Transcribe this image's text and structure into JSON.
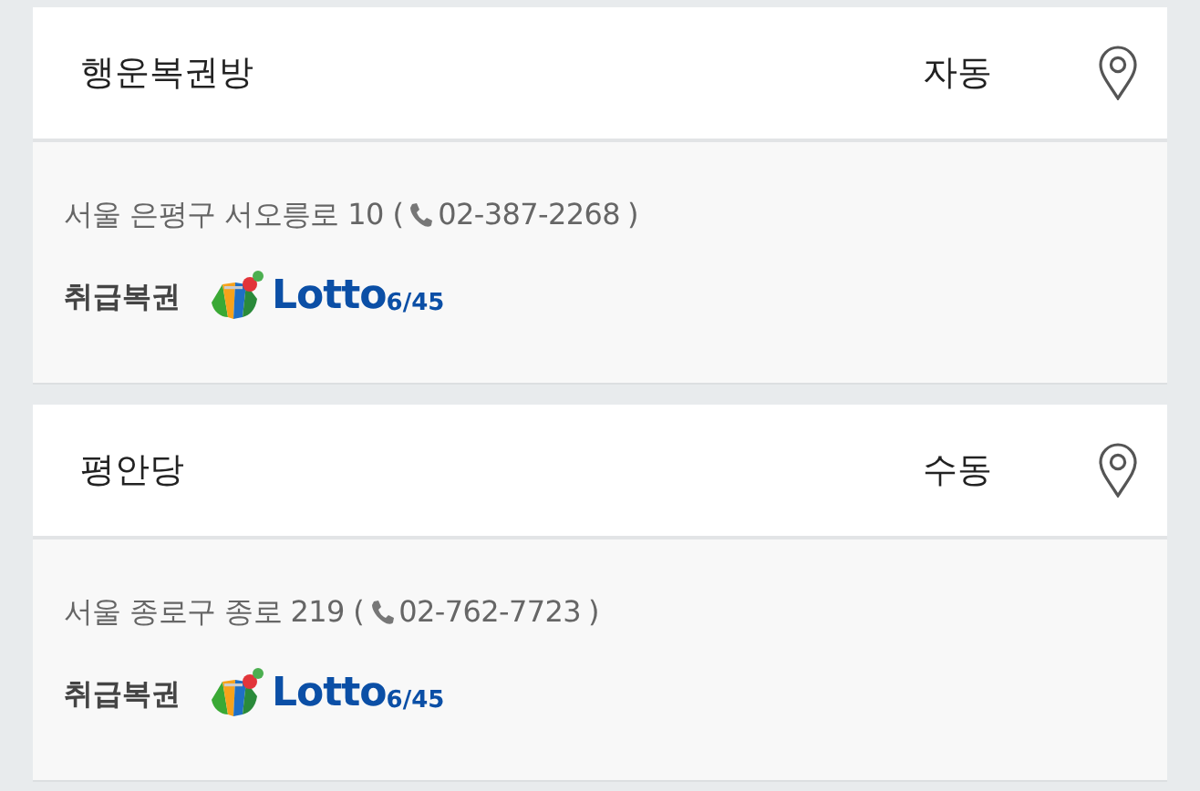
{
  "stores": [
    {
      "name": "행운복권방",
      "sale_type": "자동",
      "address": "서울 은평구 서오릉로 10 (",
      "phone": "02-387-2268",
      "close": ")",
      "ticket_label": "취급복권",
      "ticket_brand": "Lotto",
      "ticket_game": "6/45"
    },
    {
      "name": "평안당",
      "sale_type": "수동",
      "address": "서울 종로구 종로 219 (",
      "phone": "02-762-7723",
      "close": ")",
      "ticket_label": "취급복권",
      "ticket_brand": "Lotto",
      "ticket_game": "6/45"
    }
  ]
}
